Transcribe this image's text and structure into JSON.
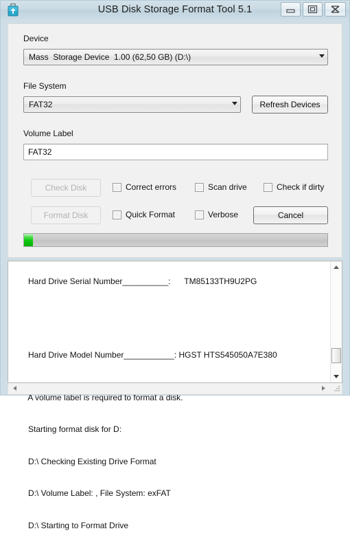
{
  "window": {
    "title": "USB Disk Storage Format Tool 5.1",
    "icon": "usb-flash-drive-icon",
    "controls": {
      "minimize": "minimize-icon",
      "maximize": "restore-icon",
      "close": "close-icon"
    },
    "colors": {
      "titlebar": "#c9dae3",
      "frame": "#cfdee6",
      "panel": "#f1f1f1",
      "progress_green": "#0ec70e",
      "disabled_text": "#b2b2b2"
    }
  },
  "form": {
    "device": {
      "label": "Device",
      "value": "Mass  Storage Device  1.00 (62,50 GB) (D:\\)"
    },
    "file_system": {
      "label": "File System",
      "value": "FAT32"
    },
    "refresh_button": "Refresh Devices",
    "volume_label": {
      "label": "Volume Label",
      "value": "FAT32",
      "placeholder": ""
    },
    "check_disk_button": "Check Disk",
    "format_disk_button": "Format Disk",
    "cancel_button": "Cancel",
    "checkboxes": [
      {
        "label": "Correct errors",
        "checked": false
      },
      {
        "label": "Scan drive",
        "checked": false
      },
      {
        "label": "Check if dirty",
        "checked": false
      },
      {
        "label": "Quick Format",
        "checked": false
      },
      {
        "label": "Verbose",
        "checked": false
      }
    ],
    "progress": {
      "percent": 3
    }
  },
  "log": {
    "serial_line": "Hard Drive Serial Number__________:      TM85133TH9U2PG",
    "model_line": "Hard Drive Model Number___________: HGST HTS545050A7E380",
    "lines": [
      "A volume label is required to format a disk.",
      "Starting format disk for D:",
      "D:\\ Checking Existing Drive Format",
      "D:\\ Volume Label: , File System: exFAT",
      "D:\\ Starting to Format Drive"
    ]
  }
}
